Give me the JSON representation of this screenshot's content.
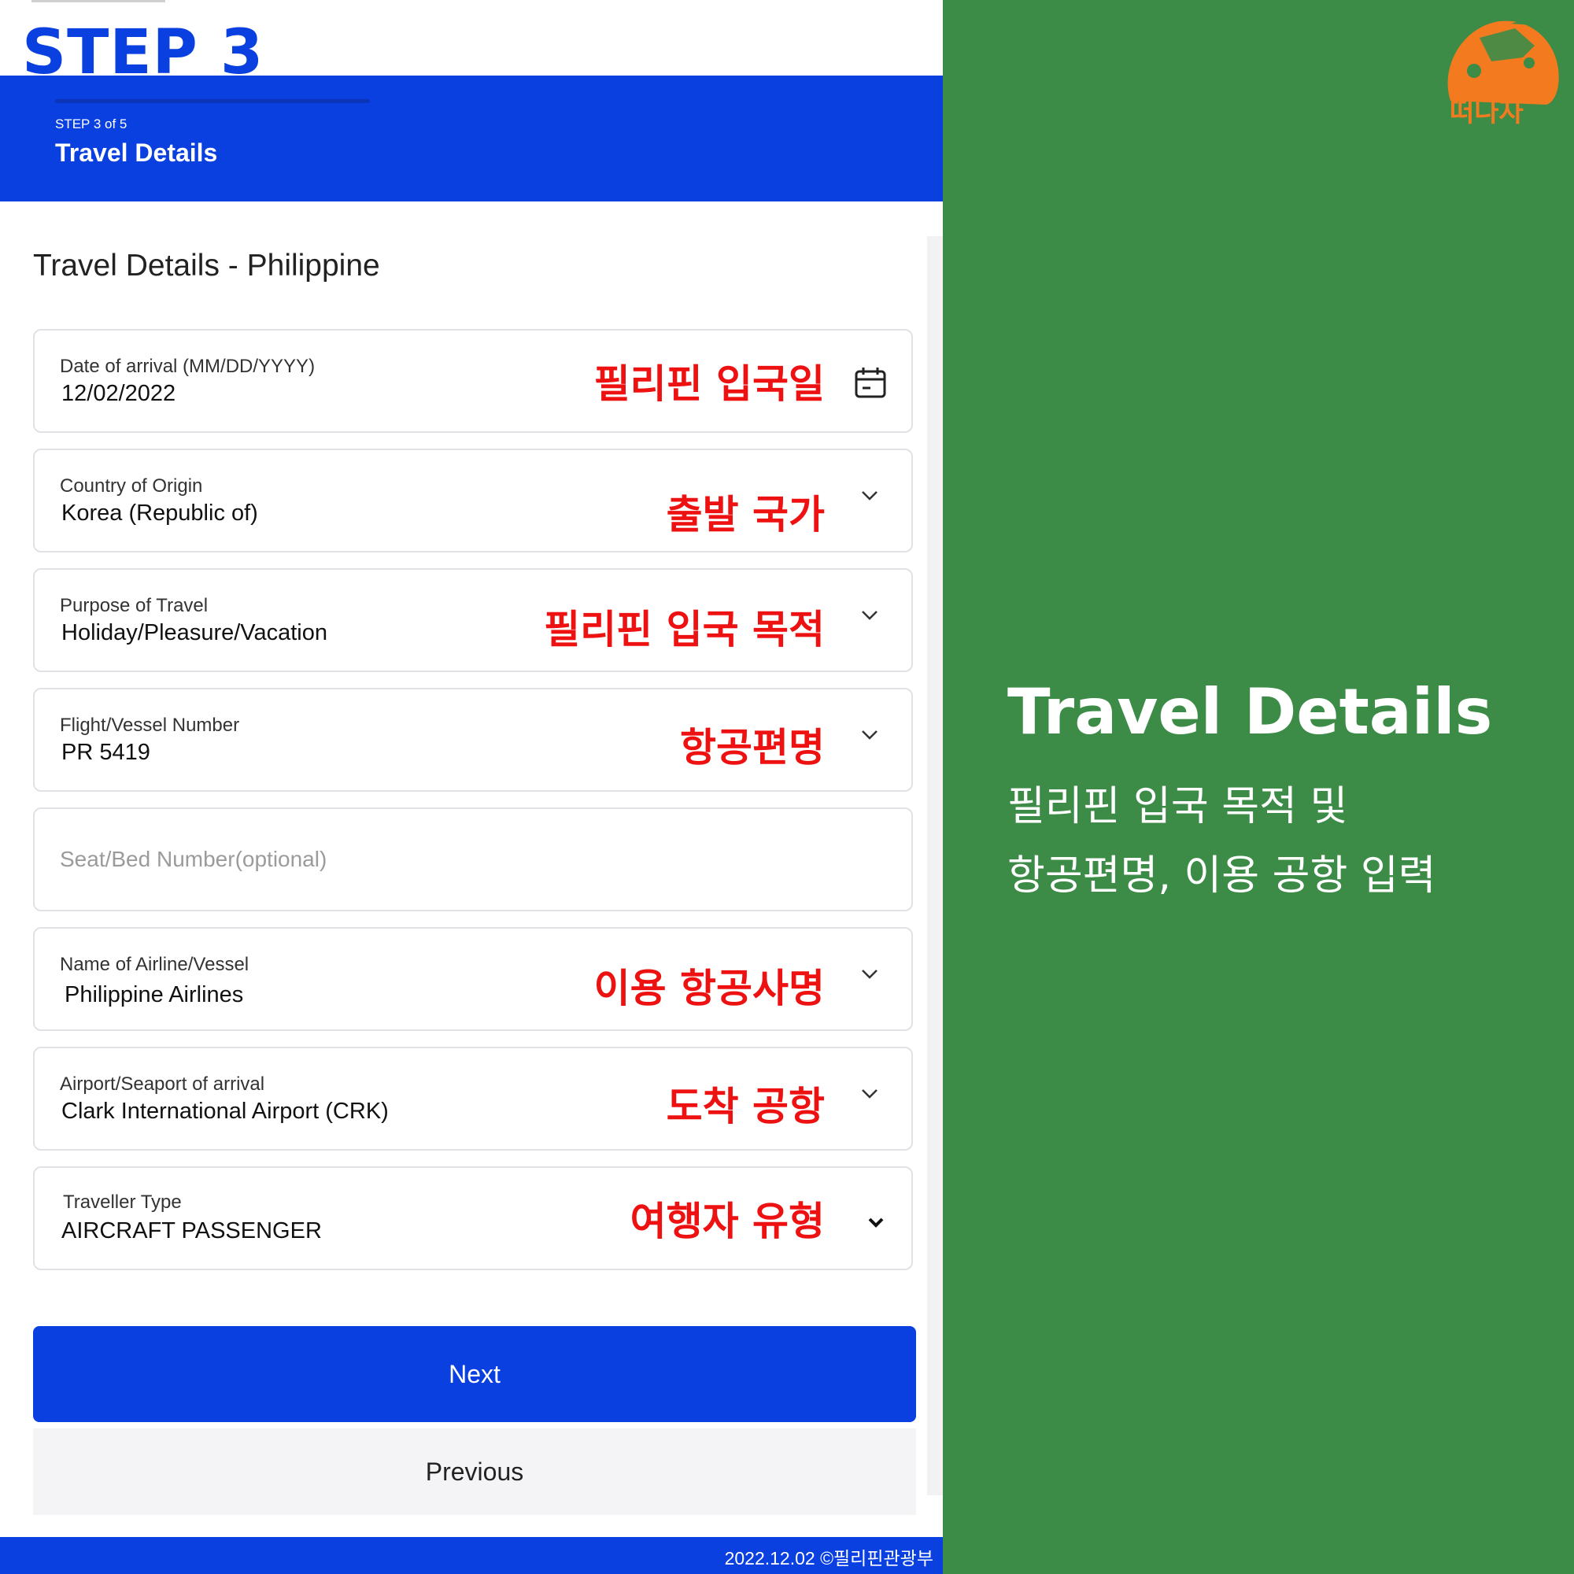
{
  "step_label": "STEP 3",
  "header": {
    "step_count": "STEP 3 of 5",
    "title": "Travel Details"
  },
  "form": {
    "title": "Travel Details - Philippine",
    "fields": [
      {
        "label": "Date of arrival (MM/DD/YYYY)",
        "value": "12/02/2022",
        "annotation": "필리핀 입국일",
        "icon": "calendar-icon"
      },
      {
        "label": "Country of Origin",
        "value": "Korea (Republic of)",
        "annotation": "출발 국가",
        "icon": "chevron-down-icon"
      },
      {
        "label": "Purpose of Travel",
        "value": "Holiday/Pleasure/Vacation",
        "annotation": "필리핀 입국 목적",
        "icon": "chevron-down-icon"
      },
      {
        "label": "Flight/Vessel Number",
        "value": "PR 5419",
        "annotation": "항공편명",
        "icon": "chevron-down-icon"
      },
      {
        "placeholder": "Seat/Bed Number(optional)"
      },
      {
        "label": "Name of Airline/Vessel",
        "value": "Philippine Airlines",
        "annotation": "이용 항공사명",
        "icon": "chevron-down-icon"
      },
      {
        "label": "Airport/Seaport of arrival",
        "value": "Clark International Airport (CRK)",
        "annotation": "도착 공항",
        "icon": "chevron-down-icon"
      },
      {
        "label": "Traveller Type",
        "value": "AIRCRAFT PASSENGER",
        "annotation": "여행자 유형",
        "icon": "chevron-down-icon"
      }
    ],
    "next_label": "Next",
    "previous_label": "Previous"
  },
  "footer": "2022.12.02 ©필리핀관광부",
  "brand": {
    "logo_text": "떠나자",
    "logo_color": "#f47a1f"
  },
  "panel": {
    "title": "Travel Details",
    "subtitle_line1": "필리핀 입국 목적 및",
    "subtitle_line2": "항공편명, 이용 공항 입력"
  },
  "colors": {
    "primary_blue": "#0a3fe0",
    "annotation_red": "#ee1111",
    "panel_green": "#3c8c47"
  }
}
